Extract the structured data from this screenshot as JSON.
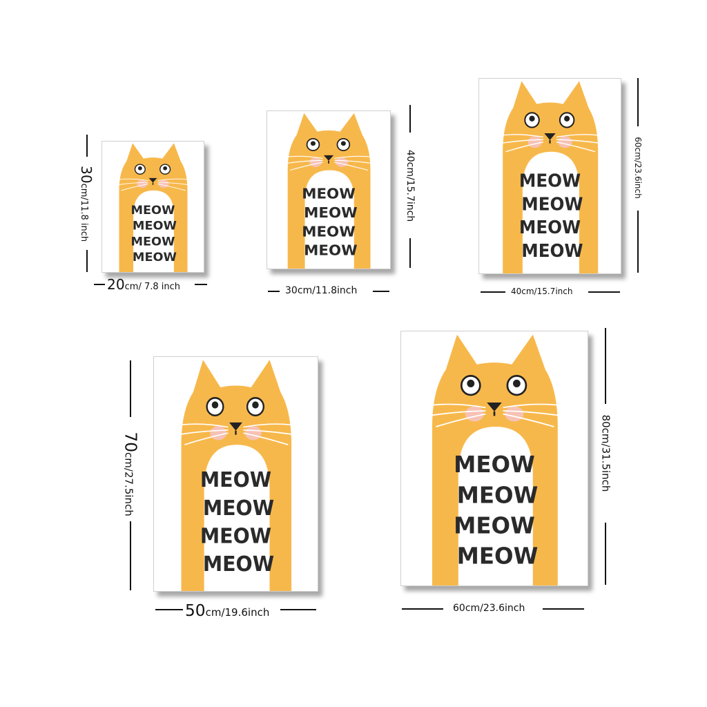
{
  "colors": {
    "cat": "#f7b84b",
    "belly": "#ffffff",
    "cheek": "#f6c2b4",
    "text": "#2a2a2a",
    "dim_line": "#111111"
  },
  "poster_text": {
    "line1": "MEOW",
    "line2": "MEOW",
    "line3": "MEOW",
    "line4": "MEOW"
  },
  "sizes": [
    {
      "height_num": "30",
      "height_rest": "cm/11.8 inch",
      "width_num": "20",
      "width_rest": "cm/ 7.8 inch"
    },
    {
      "height_label": "40cm/15.7inch",
      "width_label": "30cm/11.8inch"
    },
    {
      "height_label": "60cm/23.6inch",
      "width_label": "40cm/15.7inch"
    },
    {
      "height_num": "70",
      "height_rest": "cm/27.5inch",
      "width_num": "50",
      "width_rest": "cm/19.6inch"
    },
    {
      "height_label": "80cm/31.5inch",
      "width_label": "60cm/23.6inch"
    }
  ]
}
